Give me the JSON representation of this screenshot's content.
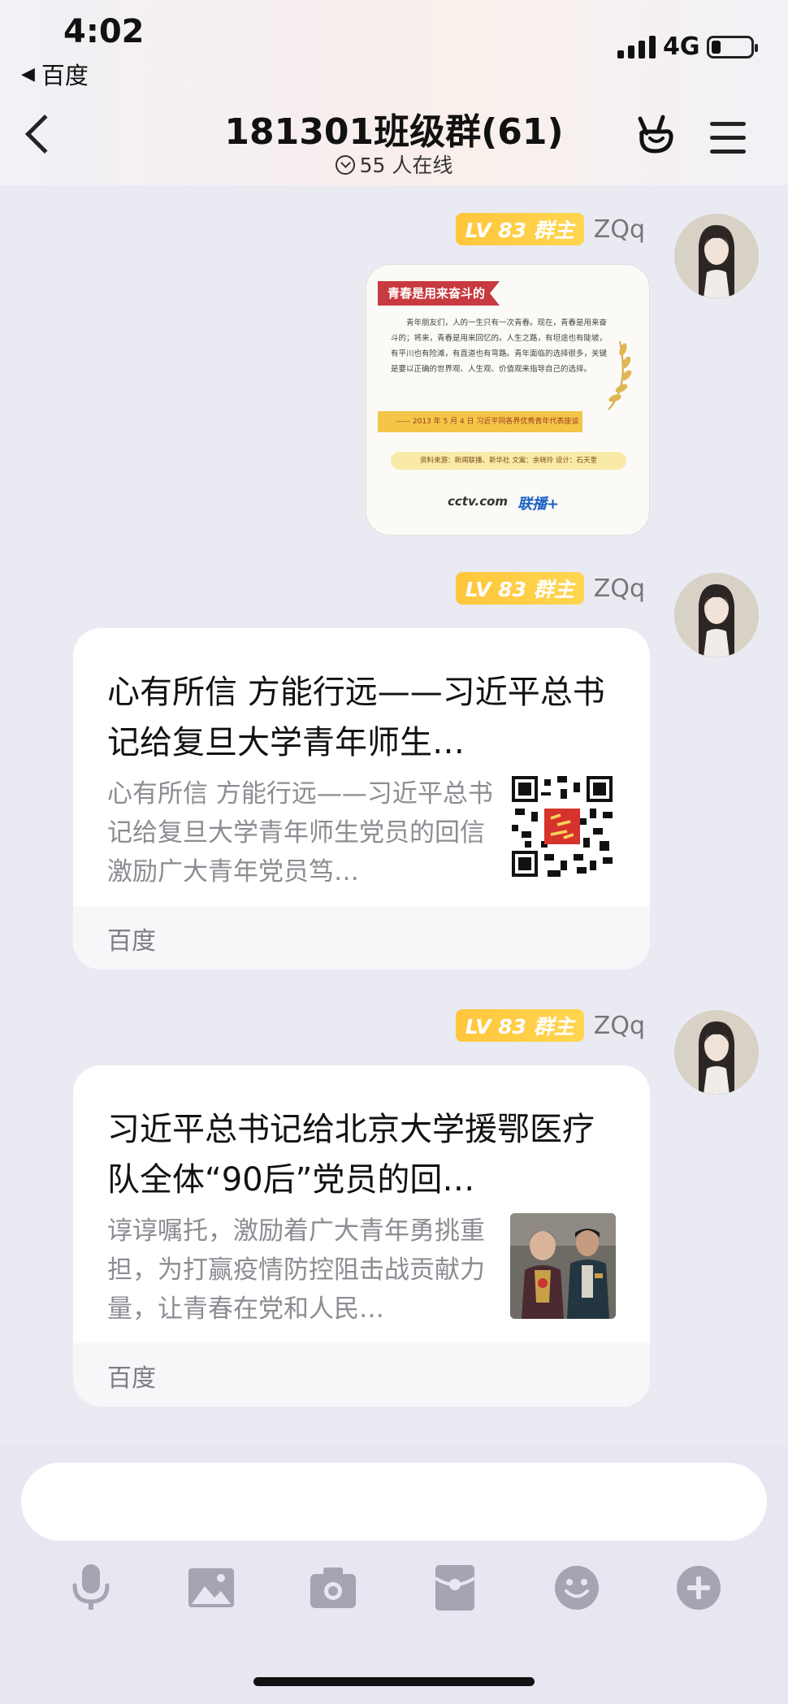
{
  "status": {
    "time": "4:02",
    "back_app": "百度",
    "network": "4G"
  },
  "header": {
    "title": "181301班级群(61)",
    "online": "55 人在线"
  },
  "messages": [
    {
      "level_badge": "LV 83 群主",
      "sender": "ZQq",
      "type": "image",
      "image": {
        "banner": "青春是用来奋斗的",
        "body": "青年朋友们，人的一生只有一次青春。现在，青春是用来奋斗的；将来，青春是用来回忆的。人生之路，有坦途也有陡坡，有平川也有险滩，有直道也有弯路。青年面临的选择很多，关键是要以正确的世界观、人生观、价值观来指导自己的选择。",
        "quote": "—— 2013 年 5 月 4 日  习近平同各界优秀青年代表座谈",
        "source": "资料来源：新闻联播、新华社      文案：余晓玲      设计：石天奎",
        "logo1": "cctv.com",
        "logo2": "联播+"
      }
    },
    {
      "level_badge": "LV 83 群主",
      "sender": "ZQq",
      "type": "link",
      "title": "心有所信 方能行远——习近平总书记给复旦大学青年师生…",
      "desc": "心有所信 方能行远——习近平总书记给复旦大学青年师生党员的回信激励广大青年党员笃…",
      "source": "百度",
      "thumb": "qr-code"
    },
    {
      "level_badge": "LV 83 群主",
      "sender": "ZQq",
      "type": "link",
      "title": "习近平总书记给北京大学援鄂医疗队全体“90后”党员的回…",
      "desc": "谆谆嘱托，激励着广大青年勇挑重担，为打赢疫情防控阻击战贡献力量，让青春在党和人民…",
      "source": "百度",
      "thumb": "photo"
    }
  ],
  "toolbar": {
    "icons": [
      "microphone-icon",
      "image-icon",
      "camera-icon",
      "red-packet-icon",
      "emoji-icon",
      "plus-icon"
    ]
  },
  "colors": {
    "badge": "#ffc63d",
    "background": "#eaeaf3",
    "icon_gray": "#a4a4b3"
  }
}
